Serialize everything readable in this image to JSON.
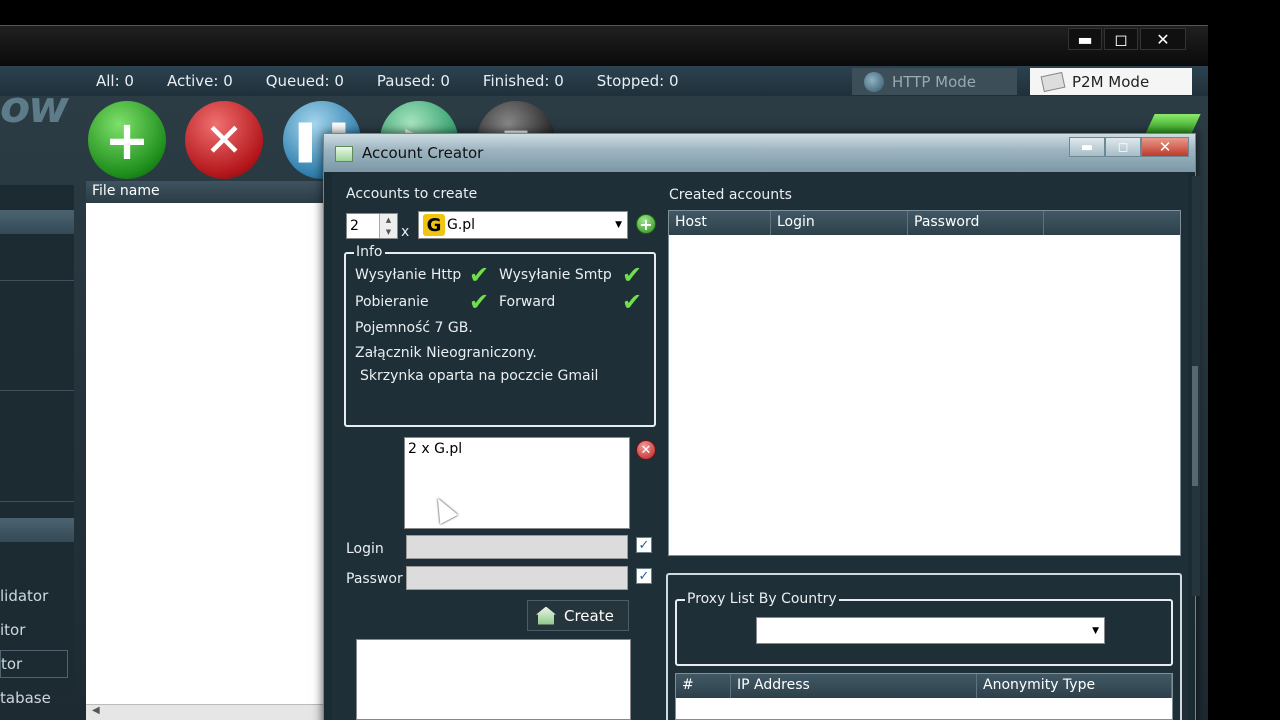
{
  "window": {
    "controls": {
      "minimize": "▬",
      "maximize": "◻",
      "close": "✕"
    }
  },
  "stats": {
    "all": "All: 0",
    "active": "Active: 0",
    "queued": "Queued: 0",
    "paused": "Paused: 0",
    "finished": "Finished: 0",
    "stopped": "Stopped: 0"
  },
  "modes": {
    "http": "HTTP Mode",
    "p2m": "P2M Mode"
  },
  "logo_fragment": "ow",
  "left_nav": {
    "items": [
      "lidator",
      "itor",
      "tor",
      "tabase"
    ]
  },
  "file_list": {
    "header": "File name"
  },
  "dialog": {
    "title": "Account Creator",
    "accounts_to_create_label": "Accounts to create",
    "quantity": "2",
    "multiply": "x",
    "service": "G.pl",
    "info": {
      "title": "Info",
      "http_send": "Wysyłanie Http",
      "smtp_send": "Wysyłanie Smtp",
      "download": "Pobieranie",
      "forward": "Forward",
      "capacity": "Pojemność 7  GB.",
      "attachment": "Załącznik   Nieograniczony.",
      "mailbox": "Skrzynka oparta na poczcie Gmail"
    },
    "queue_text": "2 x G.pl",
    "login_label": "Login",
    "password_label": "Passwor",
    "create_button": "Create",
    "created_accounts_label": "Created accounts",
    "created_columns": [
      "Host",
      "Login",
      "Password"
    ],
    "proxy_group": "Proxy List By Country",
    "proxy_columns": [
      "#",
      "IP Address",
      "Anonymity Type"
    ]
  },
  "colors": {
    "accent_green": "#6fe04a",
    "dialog_bg": "#1f2f37",
    "stop_red": "#b3161b"
  }
}
